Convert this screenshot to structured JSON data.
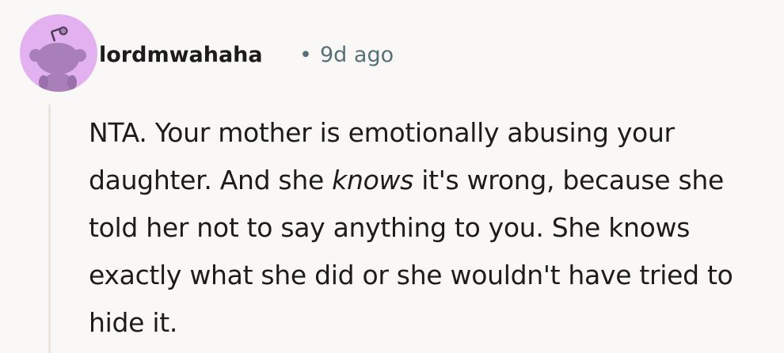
{
  "comment": {
    "author": "lordmwahaha",
    "separator": "•",
    "timestamp": "9d ago",
    "avatar_icon": "reddit-snoo-avatar-icon",
    "avatar_color": "#e3b0f0",
    "body": {
      "part1": "NTA. Your mother is emotionally abusing your daughter. And she ",
      "emphasis": "knows",
      "part2": " it's wrong, because she told her not to say anything to you. She knows exactly what she did or she wouldn't have tried to hide it."
    }
  }
}
